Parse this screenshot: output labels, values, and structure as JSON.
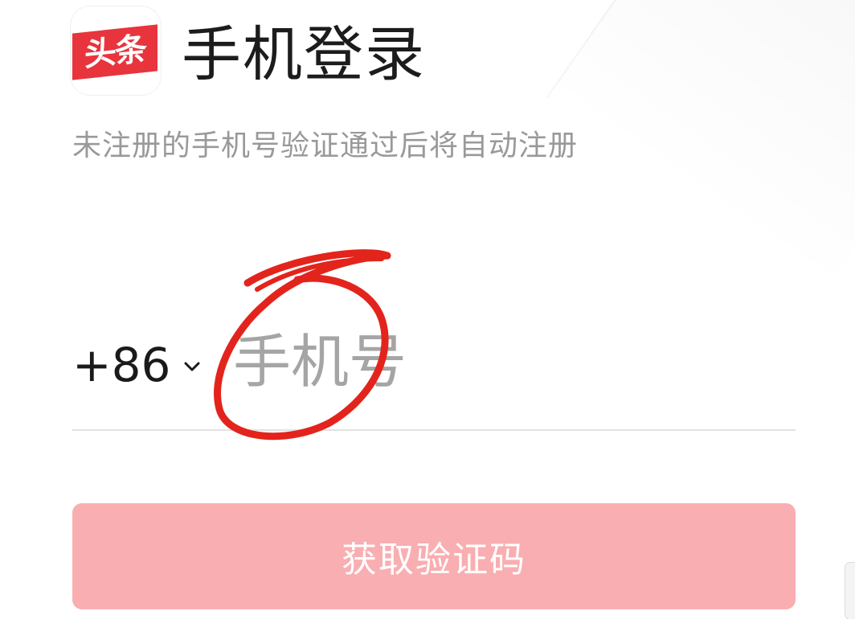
{
  "app_icon": {
    "label": "头条",
    "brand_color": "#e8343d"
  },
  "header": {
    "title": "手机登录",
    "subtitle": "未注册的手机号验证通过后将自动注册"
  },
  "phone": {
    "country_code": "+86",
    "placeholder": "手机号",
    "value": ""
  },
  "submit": {
    "label": "获取验证码",
    "color": "#f9aeb1"
  },
  "annotation": {
    "shape": "hand-drawn circle",
    "color": "#e3241c"
  },
  "icons": {
    "country_dropdown": "chevron-down-icon"
  }
}
